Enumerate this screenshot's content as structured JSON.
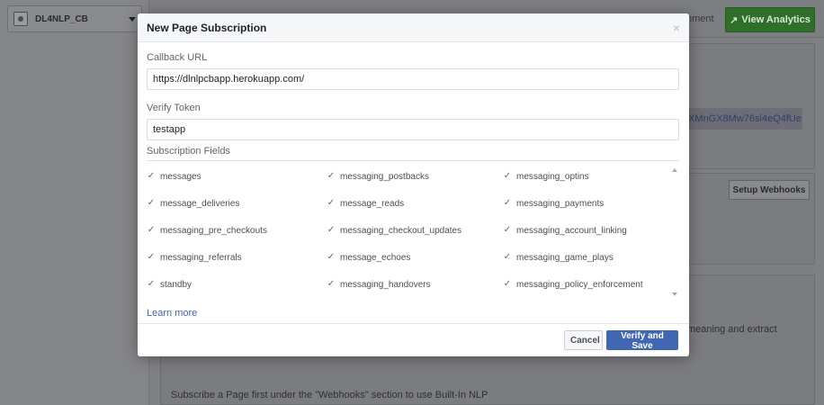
{
  "background": {
    "app_name": "DL4NLP_CB",
    "nav_partial_text": "nment",
    "view_analytics_label": "View Analytics",
    "token_partial": "tXMnGX8Mw76sl4eQ4fUe",
    "setup_webhooks_label": "Setup Webhooks",
    "meaning_text": "meaning and extract",
    "subscribe_note": "Subscribe a Page first under the \"Webhooks\" section to use Built-In NLP"
  },
  "modal": {
    "title": "New Page Subscription",
    "close_glyph": "×",
    "callback_label": "Callback URL",
    "callback_value": "https://dlnlpcbapp.herokuapp.com/",
    "verify_label": "Verify Token",
    "verify_value": "testapp",
    "subscription_label": "Subscription Fields",
    "fields": [
      {
        "label": "messages",
        "checked": true
      },
      {
        "label": "messaging_postbacks",
        "checked": true
      },
      {
        "label": "messaging_optins",
        "checked": true
      },
      {
        "label": "message_deliveries",
        "checked": true
      },
      {
        "label": "message_reads",
        "checked": true
      },
      {
        "label": "messaging_payments",
        "checked": true
      },
      {
        "label": "messaging_pre_checkouts",
        "checked": true
      },
      {
        "label": "messaging_checkout_updates",
        "checked": true
      },
      {
        "label": "messaging_account_linking",
        "checked": true
      },
      {
        "label": "messaging_referrals",
        "checked": true
      },
      {
        "label": "message_echoes",
        "checked": true
      },
      {
        "label": "messaging_game_plays",
        "checked": true
      },
      {
        "label": "standby",
        "checked": true
      },
      {
        "label": "messaging_handovers",
        "checked": true
      },
      {
        "label": "messaging_policy_enforcement",
        "checked": true
      }
    ],
    "learn_more": "Learn more",
    "cancel_label": "Cancel",
    "verify_save_label": "Verify and Save"
  },
  "colors": {
    "primary": "#4267b2",
    "analytics_green": "#42b72a",
    "overlay": "#7f8083"
  },
  "icons": {
    "check": "checkmark-icon",
    "close": "close-icon",
    "trend": "trend-up-icon"
  }
}
